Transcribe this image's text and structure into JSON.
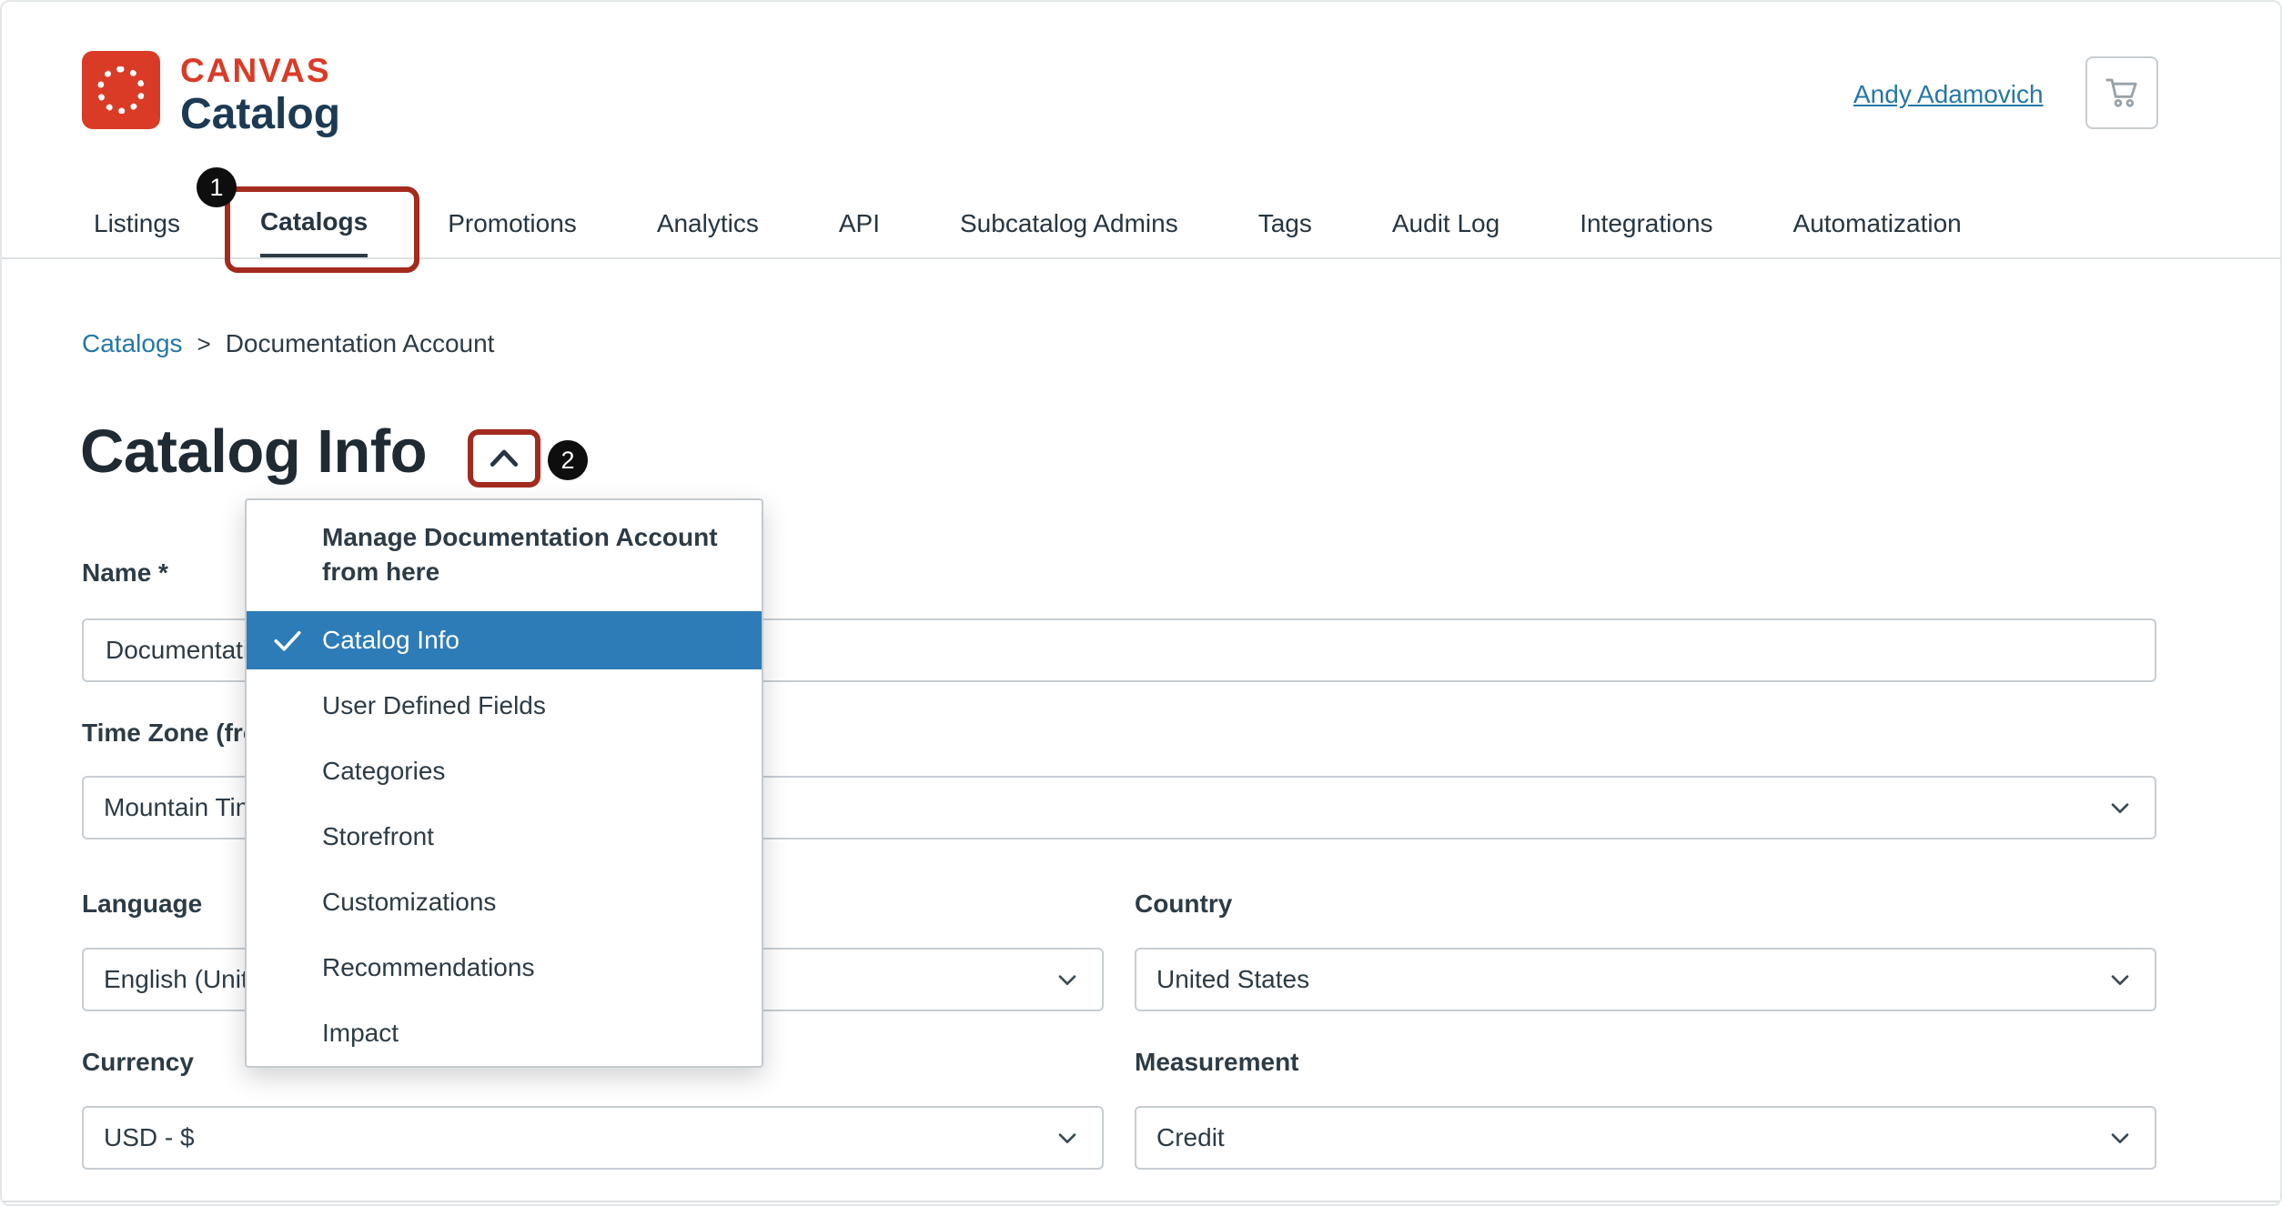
{
  "brand": {
    "line1": "CANVAS",
    "line2": "Catalog"
  },
  "header": {
    "user_name": "Andy Adamovich"
  },
  "nav": {
    "items": [
      {
        "label": "Listings"
      },
      {
        "label": "Catalogs"
      },
      {
        "label": "Promotions"
      },
      {
        "label": "Analytics"
      },
      {
        "label": "API"
      },
      {
        "label": "Subcatalog Admins"
      },
      {
        "label": "Tags"
      },
      {
        "label": "Audit Log"
      },
      {
        "label": "Integrations"
      },
      {
        "label": "Automatization"
      }
    ],
    "active_item": "Catalogs"
  },
  "annotations": {
    "step_1": "1",
    "step_2": "2"
  },
  "breadcrumb": {
    "link": "Catalogs",
    "separator": ">",
    "current": "Documentation Account"
  },
  "page": {
    "title": "Catalog Info"
  },
  "menu": {
    "header": "Manage Documentation Account from here",
    "items": [
      {
        "label": "Catalog Info",
        "selected": true
      },
      {
        "label": "User Defined Fields",
        "selected": false
      },
      {
        "label": "Categories",
        "selected": false
      },
      {
        "label": "Storefront",
        "selected": false
      },
      {
        "label": "Customizations",
        "selected": false
      },
      {
        "label": "Recommendations",
        "selected": false
      },
      {
        "label": "Impact",
        "selected": false
      }
    ]
  },
  "form": {
    "name": {
      "label": "Name *",
      "value": "Documentation Account"
    },
    "time_zone": {
      "label": "Time Zone (from Canvas)",
      "value": "Mountain Time (US & Canada)"
    },
    "language": {
      "label": "Language",
      "value": "English (United States)"
    },
    "country": {
      "label": "Country",
      "value": "United States"
    },
    "currency": {
      "label": "Currency",
      "value": "USD - $"
    },
    "measurement": {
      "label": "Measurement",
      "value": "Credit"
    }
  },
  "icons": {
    "cart": "shopping-cart-icon",
    "check": "checkmark-icon",
    "collapse": "chevron-up-icon",
    "select": "chevron-down-icon"
  },
  "colors": {
    "brand_red": "#DA3B27",
    "brand_navy": "#1C3A54",
    "link_blue": "#2577A8",
    "selected_blue": "#2D7CB8",
    "annotation_red": "#A32B1E",
    "active_tab_underline": "#2D3B45"
  }
}
